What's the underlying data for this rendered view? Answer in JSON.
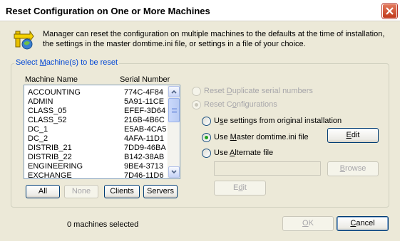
{
  "window": {
    "title": "Reset Configuration on One or More Machines",
    "close_icon": "close-x-icon"
  },
  "intro": {
    "icon": "reset-config-icon",
    "text": "Manager can reset the configuration on multiple machines to the defaults at the time of installation, the settings in the master domtime.ini file, or settings in a file of your choice."
  },
  "group": {
    "title_pre": "Select ",
    "title_ul": "M",
    "title_post": "achine(s) to be reset"
  },
  "list": {
    "col_name": "Machine Name",
    "col_serial": "Serial Number",
    "rows": [
      {
        "name": "ACCOUNTING",
        "serial": "774C-4F84"
      },
      {
        "name": "ADMIN",
        "serial": "5A91-11CE"
      },
      {
        "name": "CLASS_05",
        "serial": "EFEF-3D64"
      },
      {
        "name": "CLASS_52",
        "serial": "216B-4B6C"
      },
      {
        "name": "DC_1",
        "serial": "E5AB-4CA5"
      },
      {
        "name": "DC_2",
        "serial": "4AFA-11D1"
      },
      {
        "name": "DISTRIB_21",
        "serial": "7DD9-46BA"
      },
      {
        "name": "DISTRIB_22",
        "serial": "B142-38AB"
      },
      {
        "name": "ENGINEERING",
        "serial": "9BE4-3713"
      },
      {
        "name": "EXCHANGE",
        "serial": "7D46-11D6"
      }
    ]
  },
  "filter_buttons": {
    "all": "All",
    "none": "None",
    "clients": "Clients",
    "servers": "Servers"
  },
  "options": {
    "reset_dup_pre": "Reset ",
    "reset_dup_ul": "D",
    "reset_dup_post": "uplicate serial numbers",
    "reset_conf_pre": "Reset C",
    "reset_conf_ul": "o",
    "reset_conf_post": "nfigurations",
    "use_original_pre": "U",
    "use_original_ul": "s",
    "use_original_post": "e settings from original installation",
    "use_master_pre": "Use ",
    "use_master_ul": "M",
    "use_master_post": "aster domtime.ini file",
    "use_alt_pre": "Use ",
    "use_alt_ul": "A",
    "use_alt_post": "lternate file",
    "selected": "use_master"
  },
  "side_buttons": {
    "edit_master_ul": "E",
    "edit_master_post": "dit",
    "browse_ul": "B",
    "browse_post": "rowse",
    "edit_alt_pre": "E",
    "edit_alt_ul": "d",
    "edit_alt_post": "it"
  },
  "alternate_file": {
    "value": ""
  },
  "footer": {
    "status": "0 machines selected",
    "ok_ul": "O",
    "ok_post": "K",
    "cancel_ul": "C",
    "cancel_post": "ancel"
  }
}
